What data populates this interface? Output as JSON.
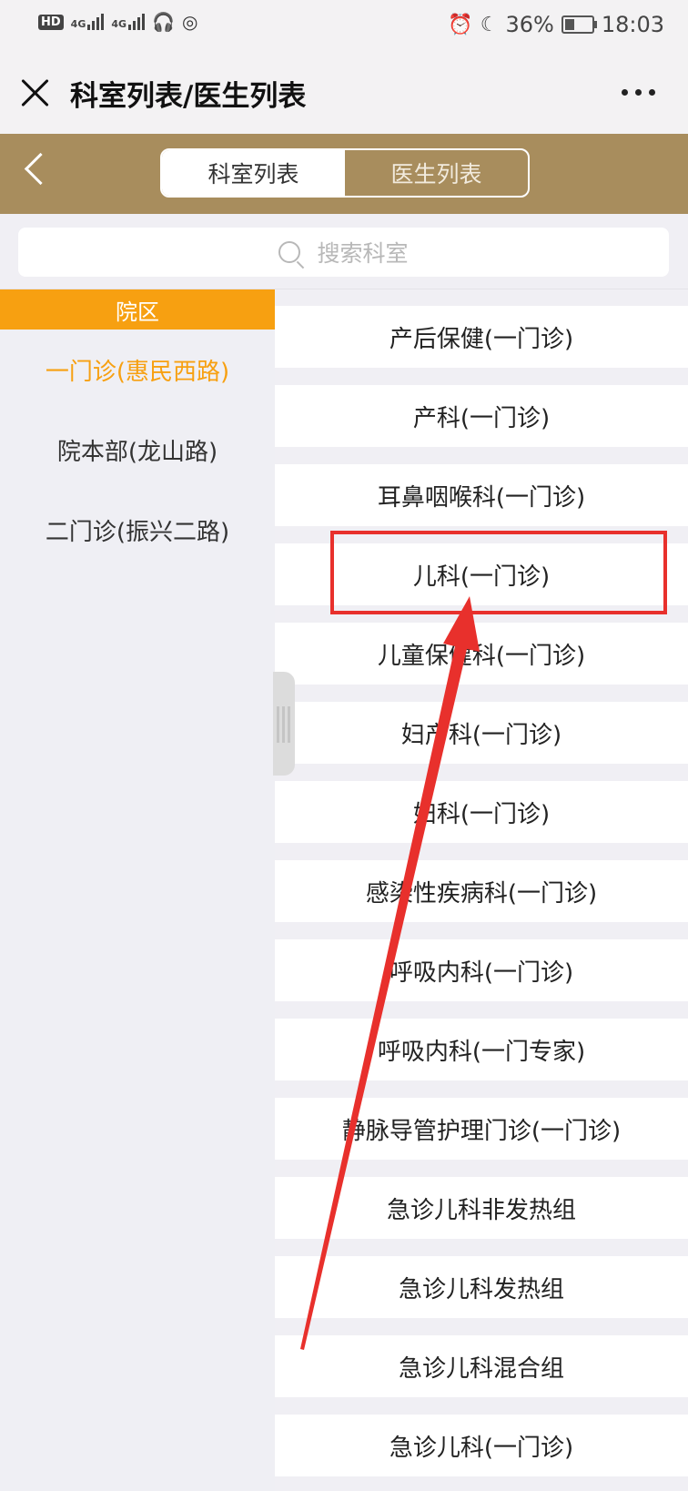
{
  "status_bar": {
    "hd": "HD",
    "sim": "1",
    "net1": "4G",
    "net2": "4G",
    "battery": "36%",
    "time": "18:03"
  },
  "header": {
    "title": "科室列表/医生列表"
  },
  "tabs": {
    "dept": "科室列表",
    "doctor": "医生列表"
  },
  "search": {
    "placeholder": "搜索科室"
  },
  "sidebar": {
    "header": "院区",
    "items": [
      "一门诊(惠民西路)",
      "院本部(龙山路)",
      "二门诊(振兴二路)"
    ],
    "selected_index": 0
  },
  "departments": [
    "产后保健(一门诊)",
    "产科(一门诊)",
    "耳鼻咽喉科(一门诊)",
    "儿科(一门诊)",
    "儿童保健科(一门诊)",
    "妇产科(一门诊)",
    "妇科(一门诊)",
    "感染性疾病科(一门诊)",
    "呼吸内科(一门诊)",
    "呼吸内科(一门专家)",
    "静脉导管护理门诊(一门诊)",
    "急诊儿科非发热组",
    "急诊儿科发热组",
    "急诊儿科混合组",
    "急诊儿科(一门诊)"
  ],
  "colors": {
    "accent": "#f7a011",
    "header_gold": "#a88d5d",
    "annotation_red": "#e8302c"
  }
}
